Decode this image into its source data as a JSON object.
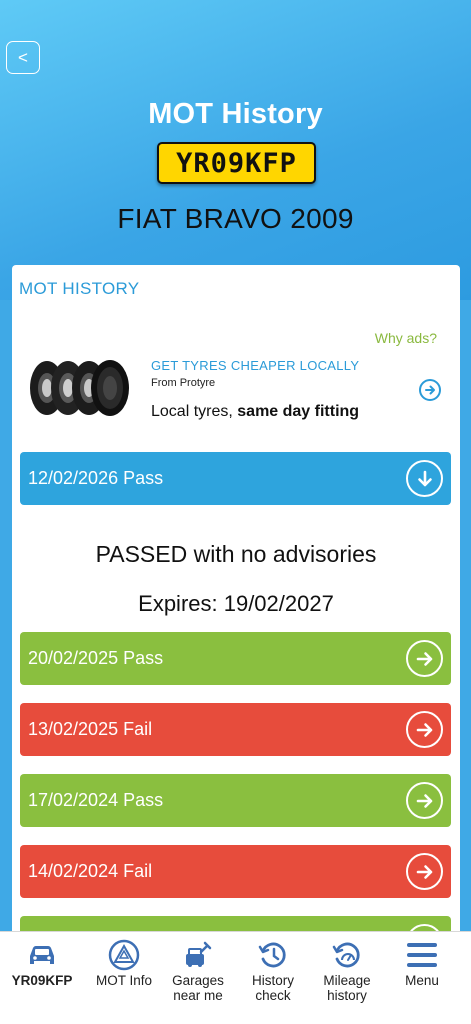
{
  "header": {
    "back_label": "<",
    "title": "MOT History",
    "plate": "YR09KFP",
    "vehicle": "FIAT BRAVO 2009"
  },
  "section_title": "MOT HISTORY",
  "ad": {
    "why_ads": "Why ads?",
    "headline": "GET TYRES CHEAPER LOCALLY",
    "from": "From Protyre",
    "body_prefix": "Local tyres, ",
    "body_bold": "same day fitting"
  },
  "current": {
    "label": "12/02/2026 Pass",
    "summary": "PASSED with no advisories",
    "expires": "Expires: 19/02/2027"
  },
  "history": [
    {
      "label": "20/02/2025 Pass",
      "result": "pass"
    },
    {
      "label": "13/02/2025 Fail",
      "result": "fail"
    },
    {
      "label": "17/02/2024 Pass",
      "result": "pass"
    },
    {
      "label": "14/02/2024 Fail",
      "result": "fail"
    }
  ],
  "nav": [
    {
      "label": "YR09KFP",
      "icon": "car-icon"
    },
    {
      "label": "MOT Info",
      "icon": "mot-triangle-icon"
    },
    {
      "label": "Garages near me",
      "icon": "garage-tools-icon"
    },
    {
      "label": "History check",
      "icon": "history-clock-icon"
    },
    {
      "label": "Mileage history",
      "icon": "speedometer-icon"
    },
    {
      "label": "Menu",
      "icon": "hamburger-menu-icon"
    }
  ],
  "colors": {
    "accent_blue": "#2ea4dd",
    "pass_green": "#8abf3f",
    "fail_red": "#e74c3c",
    "plate_yellow": "#ffd600",
    "nav_icon_blue": "#3d6fb4"
  }
}
